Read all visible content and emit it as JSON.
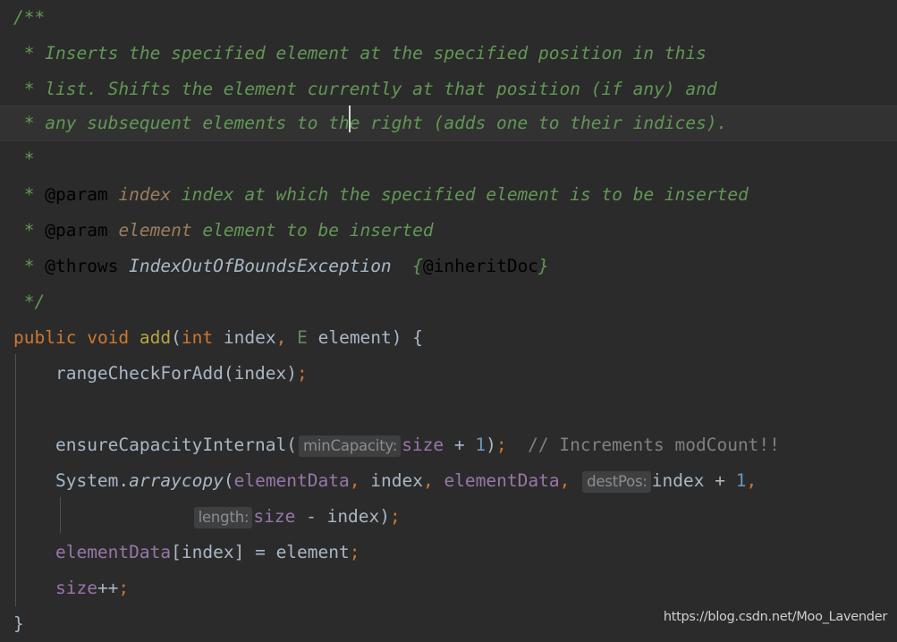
{
  "editor": {
    "background_color": "#2b2b2b",
    "current_line_background": "#323232",
    "caret_color": "#d8d8d8",
    "font_size_px": 19.5,
    "line_height_px": 40
  },
  "colors": {
    "javadoc_comment": "#629755",
    "javadoc_tag": "#629755",
    "javadoc_param_name": "#9a7e5c",
    "javadoc_type": "#a9b7c6",
    "keyword": "#cc7832",
    "method_name": "#b5a642",
    "identifier": "#a9b7c6",
    "type_parameter": "#6a8759",
    "field": "#9876aa",
    "number": "#6897bb",
    "line_comment": "#808080",
    "hint_background": "#3d3f41",
    "hint_text": "#8c8c8c",
    "indent_guide": "#4e5254"
  },
  "code": {
    "doc_open": "/**",
    "doc_close": " */",
    "star": " *",
    "line_inserts": " * Inserts the specified element at the specified position in this",
    "line_list": " * list. Shifts the element currently at that position (if any) and",
    "line_any_before_caret": " * any subsequent elements to",
    "line_any_after_caret": " the right (adds one to their indices).",
    "tag_param": "@param",
    "tag_throws": "@throws",
    "param1_name": "index",
    "param1_desc": " index at which the specified element is to be inserted",
    "param2_name": "element",
    "param2_desc": " element to be inserted",
    "throws_type": "IndexOutOfBoundsException",
    "inheritdoc_open_brace": "{",
    "inheritdoc_tag": "@inheritDoc",
    "inheritdoc_close_brace": "}",
    "kw_public": "public",
    "kw_void": "void",
    "method_add": "add",
    "paren_open": "(",
    "kw_int": "int",
    "arg_index": "index",
    "comma": ",",
    "type_E": "E",
    "arg_element": "element",
    "paren_close": ")",
    "brace_open": "{",
    "brace_close": "}",
    "call_rangecheck": "rangeCheckForAdd",
    "semicolon": ";",
    "call_ensurecapacity": "ensureCapacityInternal",
    "hint_mincapacity": "minCapacity:",
    "field_size": "size",
    "op_plus": "+",
    "num_one": "1",
    "comment_increments": "// Increments modCount!!",
    "class_system": "System",
    "dot": ".",
    "method_arraycopy": "arraycopy",
    "field_elementdata": "elementData",
    "hint_destpos": "destPos:",
    "hint_length": "length:",
    "op_minus": "-",
    "bracket_open": "[",
    "bracket_close": "]",
    "op_assign": "=",
    "op_increment": "++"
  },
  "watermark": {
    "text": "https://blog.csdn.net/Moo_Lavender"
  }
}
